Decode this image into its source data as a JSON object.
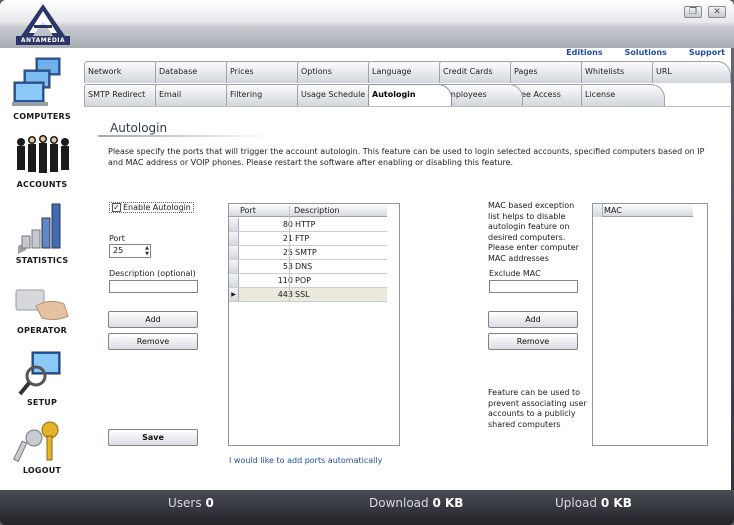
{
  "app": {
    "logo_text": "ANTAMEDIA",
    "window_buttons": [
      "restore-icon",
      "close-icon"
    ]
  },
  "sidebar": {
    "items": [
      {
        "label": "COMPUTERS",
        "icon": "computers-icon"
      },
      {
        "label": "ACCOUNTS",
        "icon": "accounts-icon"
      },
      {
        "label": "STATISTICS",
        "icon": "statistics-icon"
      },
      {
        "label": "OPERATOR",
        "icon": "operator-icon"
      },
      {
        "label": "SETUP",
        "icon": "setup-icon"
      },
      {
        "label": "LOGOUT",
        "icon": "keys-icon"
      }
    ]
  },
  "toplinks": [
    "Editions",
    "Solutions",
    "Support"
  ],
  "tabs_row1": [
    "Network",
    "Database",
    "Prices",
    "Options",
    "Language",
    "Credit Cards",
    "Pages",
    "Whitelists",
    "URL"
  ],
  "tabs_row2": [
    "SMTP Redirect",
    "Email",
    "Filtering",
    "Usage Schedule",
    "Autologin",
    "Employees",
    "Free Access",
    "License"
  ],
  "active_tab": "Autologin",
  "page": {
    "title": "Autologin",
    "intro": "Please specify the ports that will trigger the account autologin. This feature can be used to login selected accounts, specified computers based on IP and MAC address or VOIP phones. Please restart the software after enabling or disabling this feature."
  },
  "form": {
    "enable_label": "Enable Autologin",
    "enable_checked": true,
    "port_label": "Port",
    "port_value": "25",
    "description_label": "Description (optional)",
    "description_value": "",
    "add_label": "Add",
    "remove_label": "Remove",
    "save_label": "Save"
  },
  "ports_table": {
    "columns": [
      "Port",
      "Description"
    ],
    "rows": [
      {
        "port": "80",
        "description": "HTTP"
      },
      {
        "port": "21",
        "description": "FTP"
      },
      {
        "port": "25",
        "description": "SMTP"
      },
      {
        "port": "53",
        "description": "DNS"
      },
      {
        "port": "110",
        "description": "POP"
      },
      {
        "port": "443",
        "description": "SSL"
      }
    ],
    "selected_index": 5
  },
  "auto_ports_link": "I would like to add ports automatically",
  "mac": {
    "description": "MAC based exception list helps to disable autologin feature on desired computers. Please enter computer MAC addresses",
    "exclude_label": "Exclude MAC",
    "exclude_value": "",
    "add_label": "Add",
    "remove_label": "Remove",
    "column": "MAC",
    "feature_note": "Feature can be used to prevent associating user accounts to a publicly shared computers"
  },
  "status": {
    "users_label": "Users",
    "users_value": "0",
    "download_label": "Download",
    "download_value": "0 KB",
    "upload_label": "Upload",
    "upload_value": "0 KB"
  }
}
